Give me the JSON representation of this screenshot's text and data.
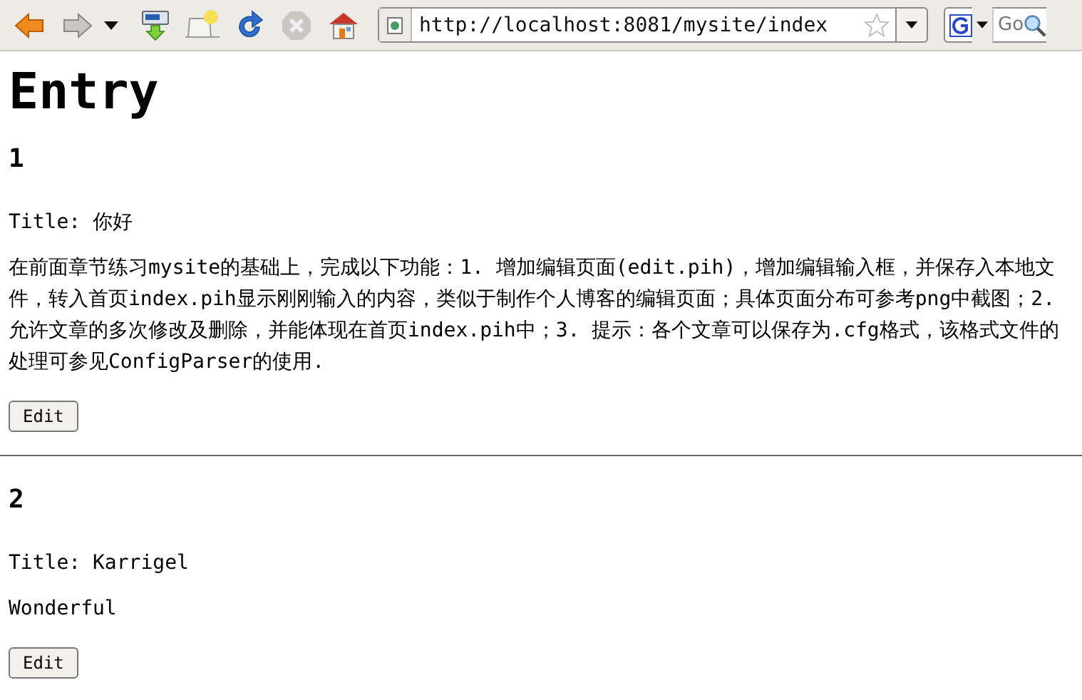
{
  "toolbar": {
    "buttons": [
      {
        "kind": "back",
        "disabled": false
      },
      {
        "kind": "forward",
        "disabled": true
      },
      {
        "kind": "history",
        "disabled": false
      },
      {
        "kind": "download",
        "disabled": false
      },
      {
        "kind": "bookmark",
        "disabled": false
      },
      {
        "kind": "reload",
        "disabled": false
      },
      {
        "kind": "stop",
        "disabled": true
      },
      {
        "kind": "home",
        "disabled": false
      }
    ]
  },
  "address_bar": {
    "url": "http://localhost:8081/mysite/index"
  },
  "search": {
    "placeholder": "Go"
  },
  "page": {
    "heading": "Entry",
    "entries": [
      {
        "number": "1",
        "title_line": "Title: 你好",
        "body": "在前面章节练习mysite的基础上，完成以下功能：1. 增加编辑页面(edit.pih)，增加编辑输入框，并保存入本地文件，转入首页index.pih显示刚刚输入的内容，类似于制作个人博客的编辑页面；具体页面分布可参考png中截图；2. 允许文章的多次修改及删除，并能体现在首页index.pih中；3. 提示：各个文章可以保存为.cfg格式，该格式文件的处理可参见ConfigParser的使用.",
        "button": "Edit"
      },
      {
        "number": "2",
        "title_line": "Title: Karrigel",
        "body": "Wonderful",
        "button": "Edit"
      }
    ]
  }
}
